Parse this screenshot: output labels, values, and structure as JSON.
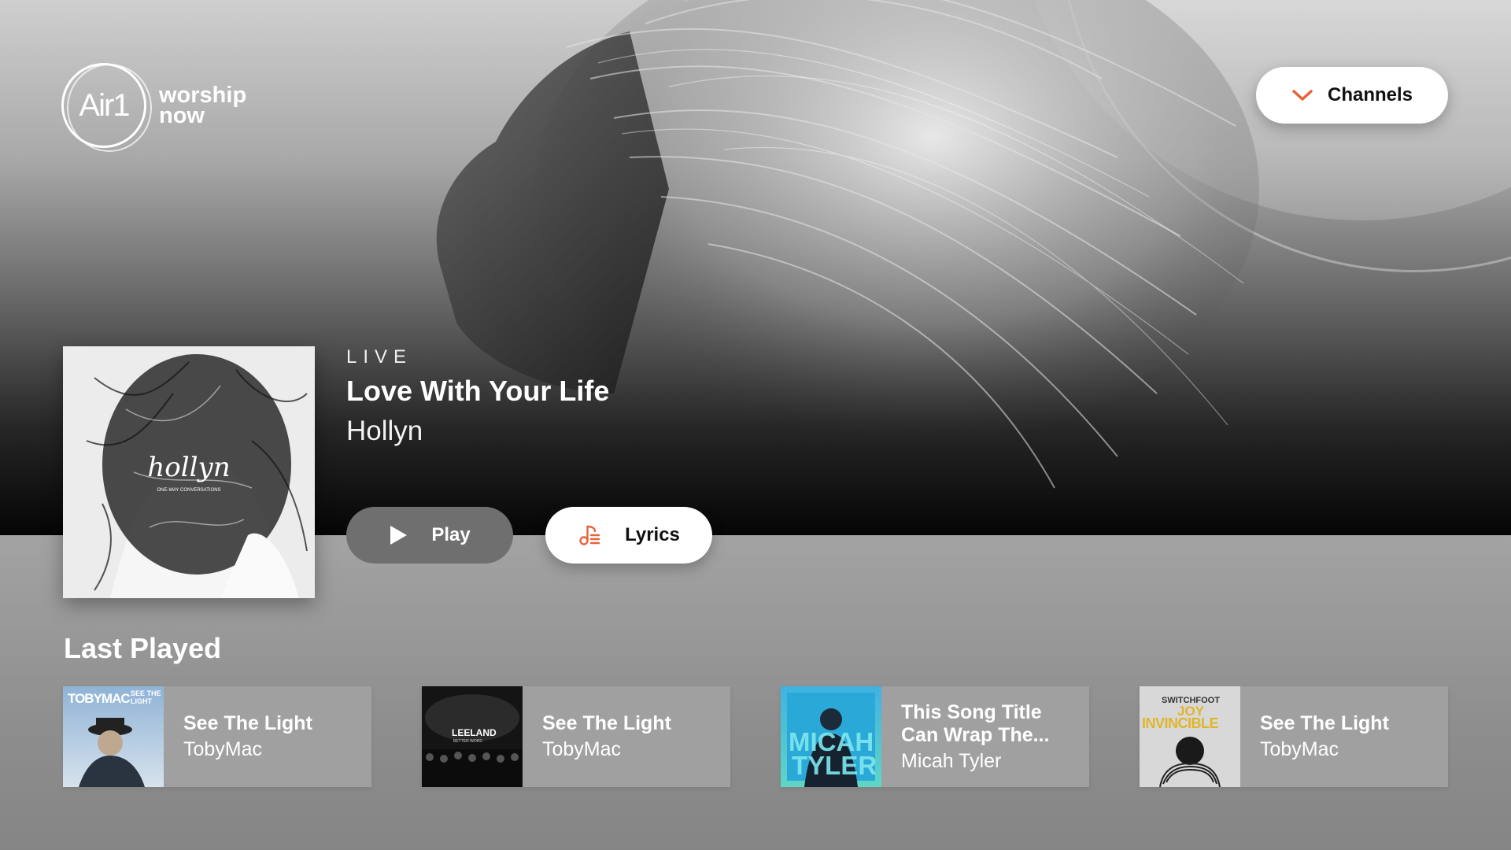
{
  "logo": {
    "mark": "Air1",
    "tagline_line1": "worship",
    "tagline_line2": "now"
  },
  "header": {
    "channels_label": "Channels",
    "channels_icon": "chevron-down-icon",
    "accent": "#e8633a"
  },
  "now_playing": {
    "status": "LIVE",
    "title": "Love With Your Life",
    "artist": "Hollyn",
    "cover_text": "hollyn",
    "cover_subtext": "ONE-WAY CONVERSATIONS"
  },
  "actions": {
    "play_label": "Play",
    "lyrics_label": "Lyrics"
  },
  "last_played": {
    "heading": "Last Played",
    "items": [
      {
        "title": "See The Light",
        "artist": "TobyMac",
        "art_text": "TOBYMAC",
        "art_sub": "SEE THE LIGHT"
      },
      {
        "title": "See The Light",
        "artist": "TobyMac",
        "art_text": "LEELAND",
        "art_sub": "BETTER WORD"
      },
      {
        "title": "This Song Title Can Wrap The...",
        "artist": "Micah Tyler",
        "art_text": "MICAH",
        "art_text2": "TYLER"
      },
      {
        "title": "See The Light",
        "artist": "TobyMac",
        "art_text": "SWITCHFOOT",
        "art_sub": "JOY",
        "art_sub2": "INVINCIBLE"
      }
    ]
  }
}
